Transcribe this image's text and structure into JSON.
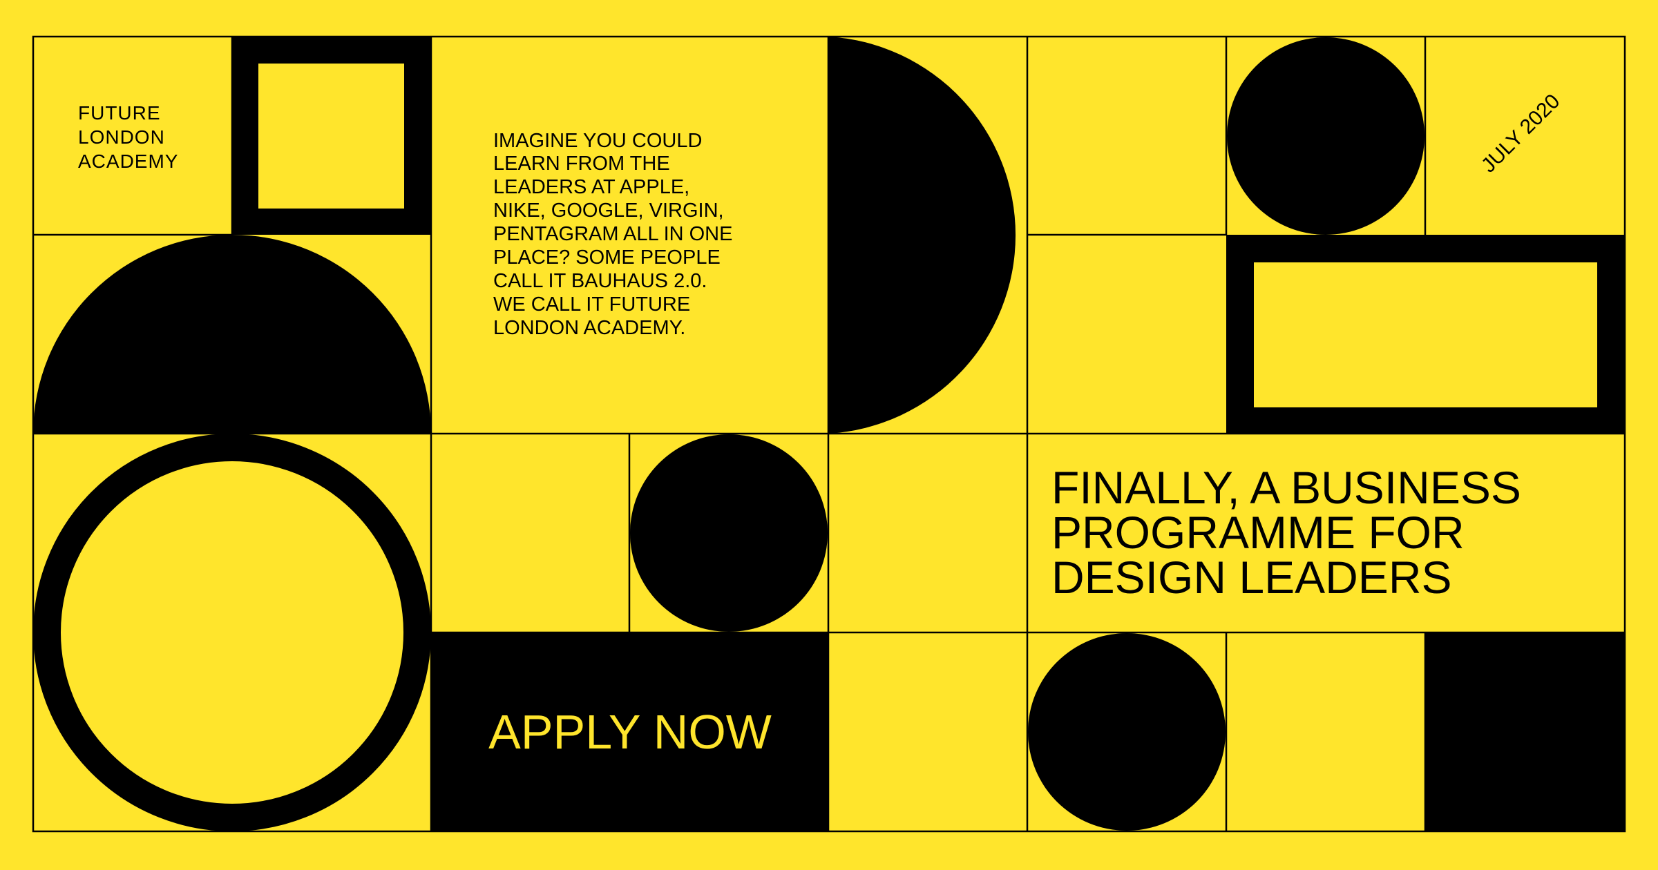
{
  "colors": {
    "background": "#FFE52C",
    "ink": "#000000"
  },
  "logo": {
    "lines": [
      "FUTURE",
      "LONDON",
      "ACADEMY"
    ]
  },
  "intro": {
    "lines": [
      "IMAGINE YOU COULD",
      "LEARN FROM THE",
      "LEADERS AT APPLE,",
      "NIKE, GOOGLE, VIRGIN,",
      "PENTAGRAM ALL IN ONE",
      "PLACE? SOME PEOPLE",
      "CALL IT BAUHAUS 2.0.",
      "WE CALL IT FUTURE",
      "LONDON ACADEMY."
    ]
  },
  "date": "JULY 2020",
  "headline": {
    "lines": [
      "FINALLY, A BUSINESS",
      "PROGRAMME FOR",
      "DESIGN LEADERS"
    ]
  },
  "cta": {
    "label": "APPLY NOW"
  }
}
